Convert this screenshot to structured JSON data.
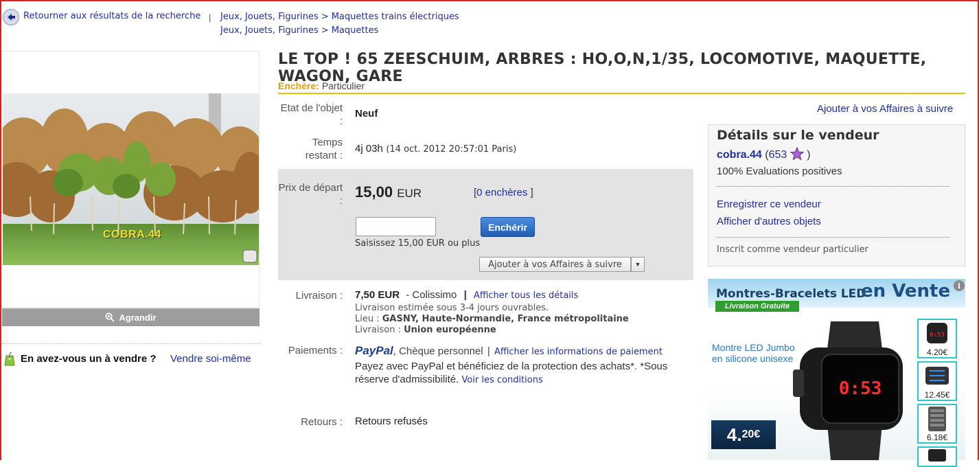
{
  "nav": {
    "back_label": "Retourner aux résultats de la recherche",
    "separator": "|",
    "breadcrumbs": [
      [
        "Jeux, Jouets, Figurines",
        "Maquettes trains électriques"
      ],
      [
        "Jeux, Jouets, Figurines",
        "Maquettes"
      ]
    ]
  },
  "gallery": {
    "watermark": "COBRA.44",
    "enlarge_label": "Agrandir"
  },
  "sell": {
    "question": "En avez-vous un à vendre ?",
    "link": "Vendre soi-même"
  },
  "listing": {
    "title": "LE TOP ! 65 ZEESCHUIM, ARBRES : HO,O,N,1/35, LOCOMOTIVE, MAQUETTE, WAGON, GARE",
    "type_key": "Enchère:",
    "type_value": "Particulier",
    "condition_label": "Etat de l'objet :",
    "condition_value": "Neuf",
    "time_label": "Temps restant :",
    "time_value": "4j 03h",
    "time_detail": "(14 oct. 2012 20:57:01 Paris)",
    "price_label": "Prix de départ :",
    "price_value": "15,00",
    "currency": "EUR",
    "bids_open": "[",
    "bids_link": "0 enchères",
    "bids_close": "]",
    "bid_button": "Enchérir",
    "bid_hint": "Saisissez 15,00 EUR ou plus",
    "watch_button": "Ajouter à vos Affaires à suivre",
    "shipping_label": "Livraison :",
    "shipping_price": "7,50 EUR",
    "shipping_carrier": "- Colissimo",
    "shipping_sep": "|",
    "shipping_details_link": "Afficher tous les détails",
    "shipping_estimate": "Livraison estimée sous 3-4 jours ouvrables.",
    "location_label": "Lieu :",
    "location_value": "GASNY, Haute-Normandie, France métropolitaine",
    "ships_to_label": "Livraison :",
    "ships_to_value": "Union européenne",
    "payments_label": "Paiements :",
    "paypal_logo": "PayPal",
    "payments_methods": ", Chèque personnel",
    "payments_sep": "|",
    "payments_info_link": "Afficher les informations de paiement",
    "payments_note": "Payez avec PayPal et bénéficiez de la protection des achats*. *Sous réserve d'admissibilité.",
    "payments_conditions_link": "Voir les conditions",
    "returns_label": "Retours :",
    "returns_value": "Retours refusés"
  },
  "seller": {
    "follow_link": "Ajouter à vos Affaires à suivre",
    "title": "Détails sur le vendeur",
    "name": "cobra.44",
    "score_open": "(",
    "score": "653",
    "score_close": ")",
    "positive": "100% Evaluations positives",
    "save_link": "Enregistrer ce vendeur",
    "other_link": "Afficher d'autres objets",
    "registered": "Inscrit comme vendeur particulier"
  },
  "ad": {
    "title_small": "Montres-Bracelets LED",
    "title_big": "en Vente",
    "shipping_badge": "Livraison Gratuite",
    "product": "Montre LED Jumbo en silicone unisexe",
    "watch_display": "0:53",
    "price_main": "4.",
    "price_cents": "20€",
    "info": "i",
    "thumbs": [
      "4.20€",
      "12.45€",
      "6.18€"
    ]
  },
  "colors": {
    "link": "#1f2fa0",
    "auction_label": "#e39d0c",
    "rule": "#e8c300",
    "bid_button": "#1f5cb5",
    "frame": "#d9221f"
  }
}
